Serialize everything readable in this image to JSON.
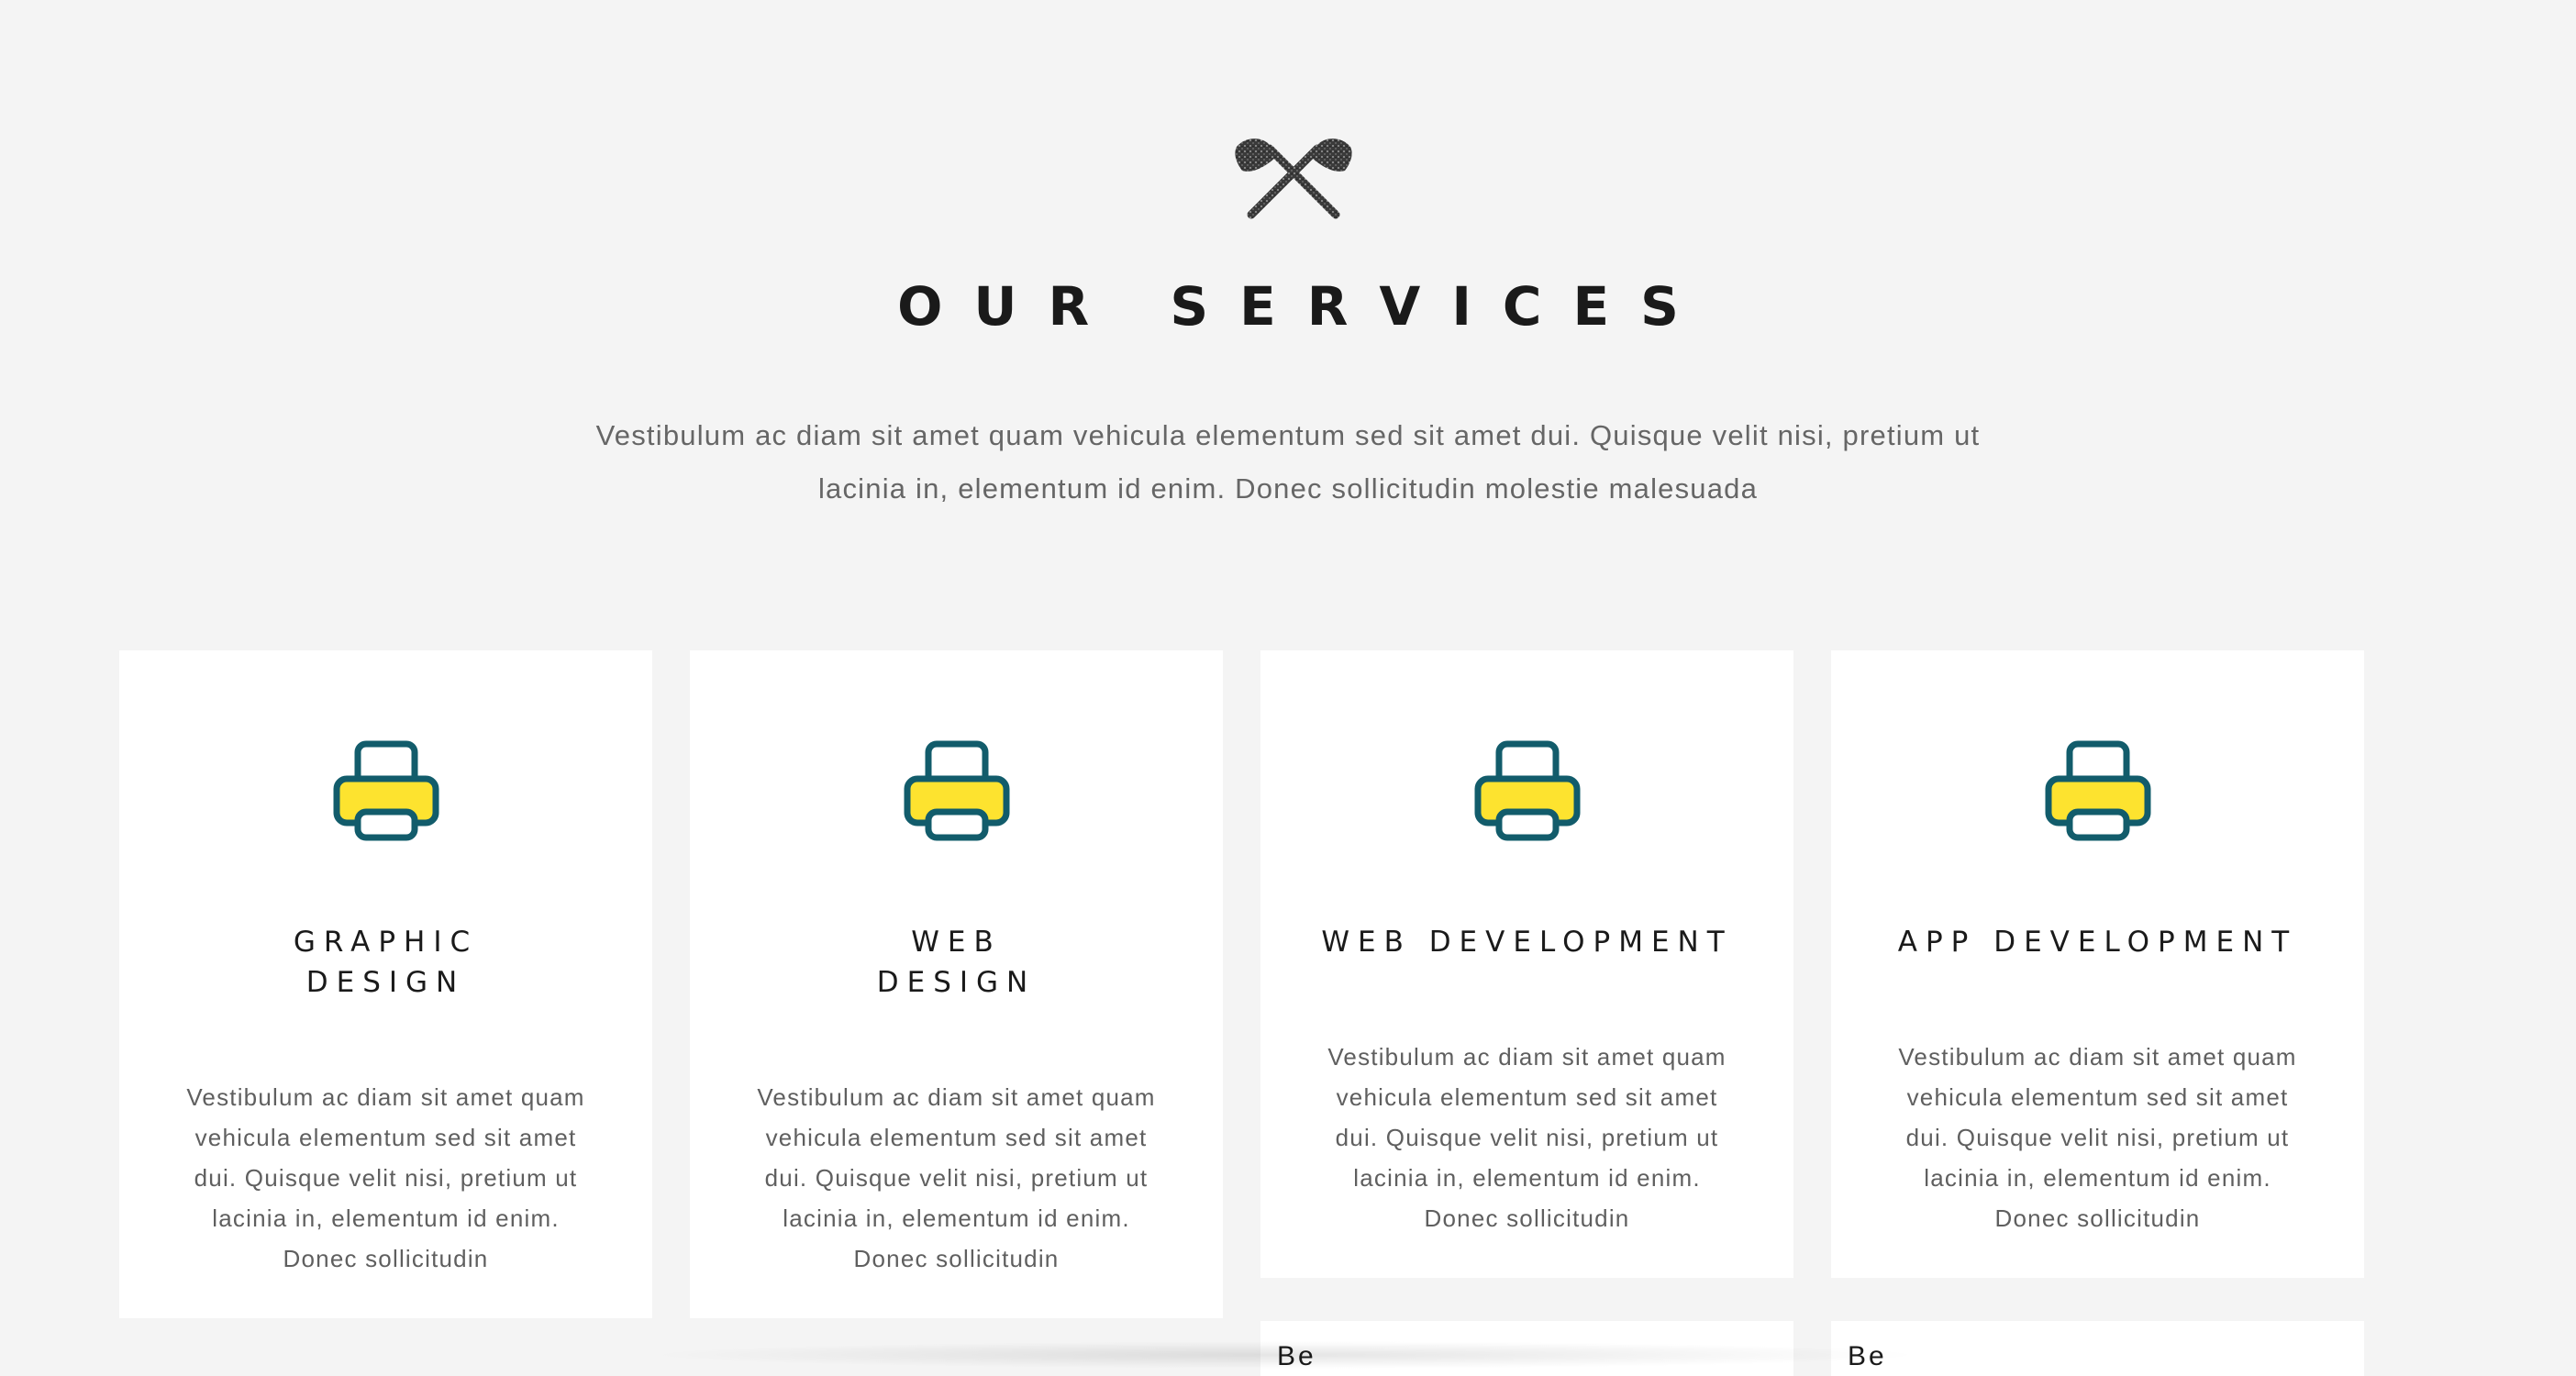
{
  "header": {
    "title": "OUR SERVICES",
    "intro": "Vestibulum ac diam sit amet quam vehicula elementum sed sit amet dui. Quisque velit nisi, pretium ut lacinia in, elementum id enim. Donec sollicitudin molestie malesuada",
    "icon": "crossed-axes-icon"
  },
  "colors": {
    "printer_outline": "#125c6b",
    "printer_fill": "#fde32f",
    "background": "#f4f4f4"
  },
  "services": [
    {
      "icon": "printer-icon",
      "title": "GRAPHIC\nDESIGN",
      "text": "Vestibulum ac diam sit amet quam vehicula elementum sed sit amet dui. Quisque velit nisi, pretium ut lacinia in, elementum id enim. Donec sollicitudin"
    },
    {
      "icon": "printer-icon",
      "title": "WEB\nDESIGN",
      "text": "Vestibulum ac diam sit amet quam vehicula elementum sed sit amet dui. Quisque velit nisi, pretium ut lacinia in, elementum id enim. Donec sollicitudin"
    },
    {
      "icon": "printer-icon",
      "title": "WEB DEVELOPMENT",
      "text": "Vestibulum ac diam sit amet quam vehicula elementum sed sit amet dui. Quisque velit nisi, pretium ut lacinia in, elementum id enim. Donec sollicitudin"
    },
    {
      "icon": "printer-icon",
      "title": "APP DEVELOPMENT",
      "text": "Vestibulum ac diam sit amet quam vehicula elementum sed sit amet dui. Quisque velit nisi, pretium ut lacinia in, elementum id enim. Donec sollicitudin"
    }
  ],
  "next_row": [
    {
      "partial_text": "Be"
    },
    {
      "partial_text": "Be"
    }
  ]
}
